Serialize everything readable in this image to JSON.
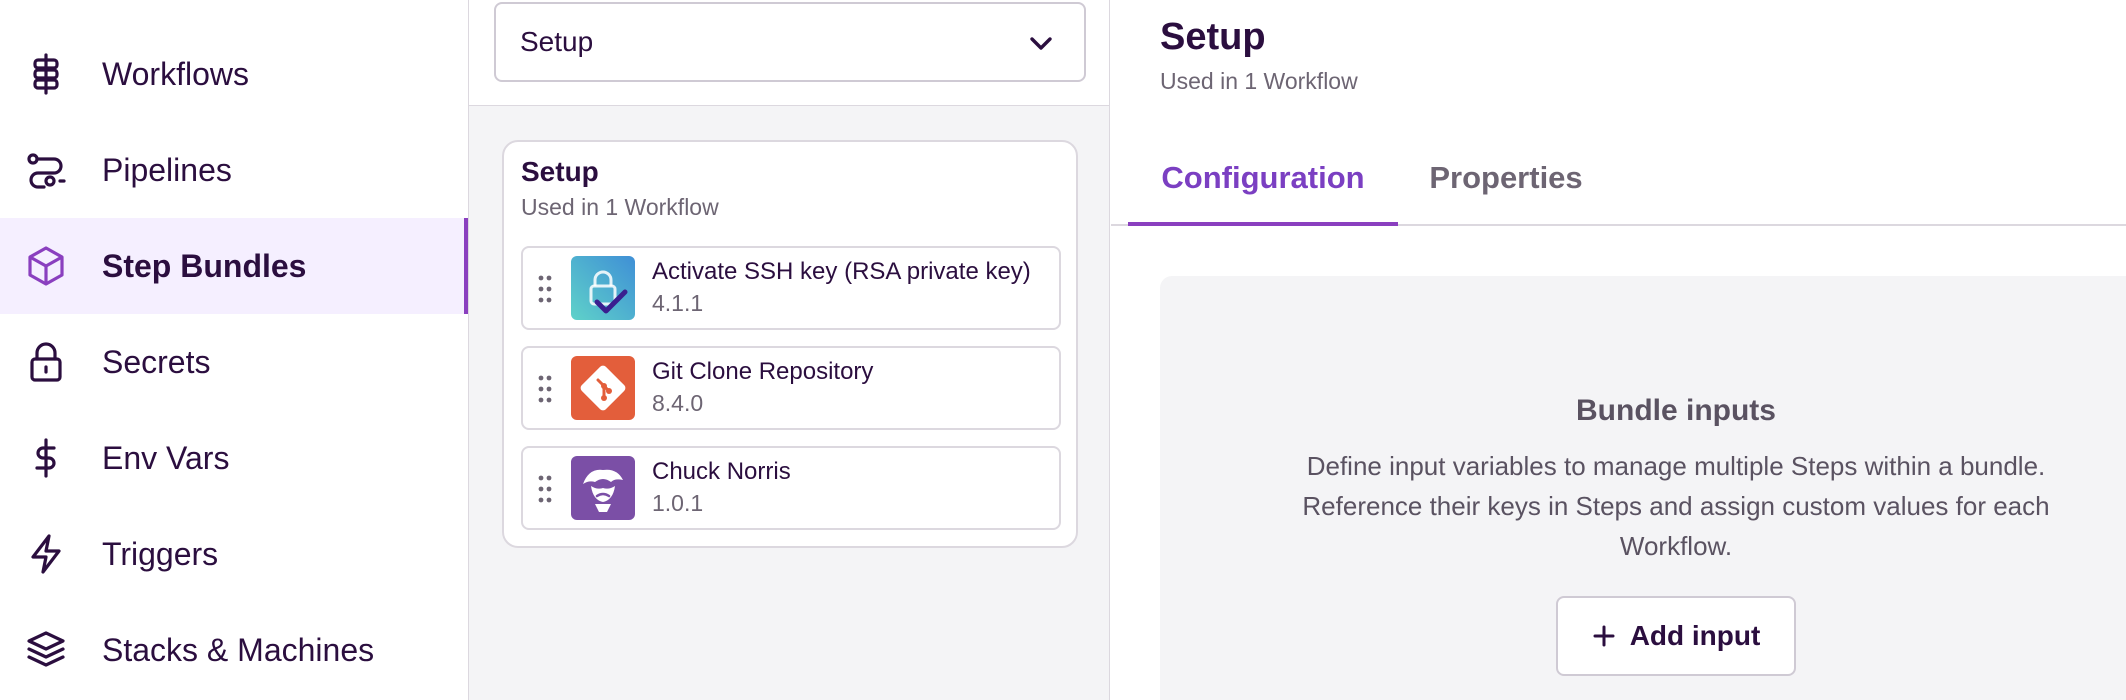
{
  "sidebar": {
    "items": [
      {
        "label": "Workflows",
        "icon": "workflows-icon"
      },
      {
        "label": "Pipelines",
        "icon": "pipelines-icon"
      },
      {
        "label": "Step Bundles",
        "icon": "cube-icon",
        "active": true
      },
      {
        "label": "Secrets",
        "icon": "lock-icon"
      },
      {
        "label": "Env Vars",
        "icon": "dollar-icon"
      },
      {
        "label": "Triggers",
        "icon": "lightning-icon"
      },
      {
        "label": "Stacks & Machines",
        "icon": "layers-icon"
      }
    ]
  },
  "bundle_select": {
    "value": "Setup"
  },
  "bundle_card": {
    "title": "Setup",
    "subtitle": "Used in 1 Workflow",
    "steps": [
      {
        "name": "Activate SSH key (RSA private key)",
        "version": "4.1.1",
        "icon": "ssh-key-icon"
      },
      {
        "name": "Git Clone Repository",
        "version": "8.4.0",
        "icon": "git-icon"
      },
      {
        "name": "Chuck Norris",
        "version": "1.0.1",
        "icon": "chuck-norris-icon"
      }
    ]
  },
  "detail": {
    "title": "Setup",
    "subtitle": "Used in 1 Workflow",
    "tabs": [
      {
        "label": "Configuration",
        "active": true
      },
      {
        "label": "Properties",
        "active": false
      }
    ],
    "inputs_box": {
      "title": "Bundle inputs",
      "description": "Define input variables to manage multiple Steps within a bundle. Reference their keys in Steps and assign custom values for each Workflow.",
      "button_label": "Add input"
    }
  },
  "colors": {
    "accent": "#8a3fbf",
    "active_bg": "#f5efff",
    "text": "#2b0e3f",
    "muted": "#6d6573"
  }
}
